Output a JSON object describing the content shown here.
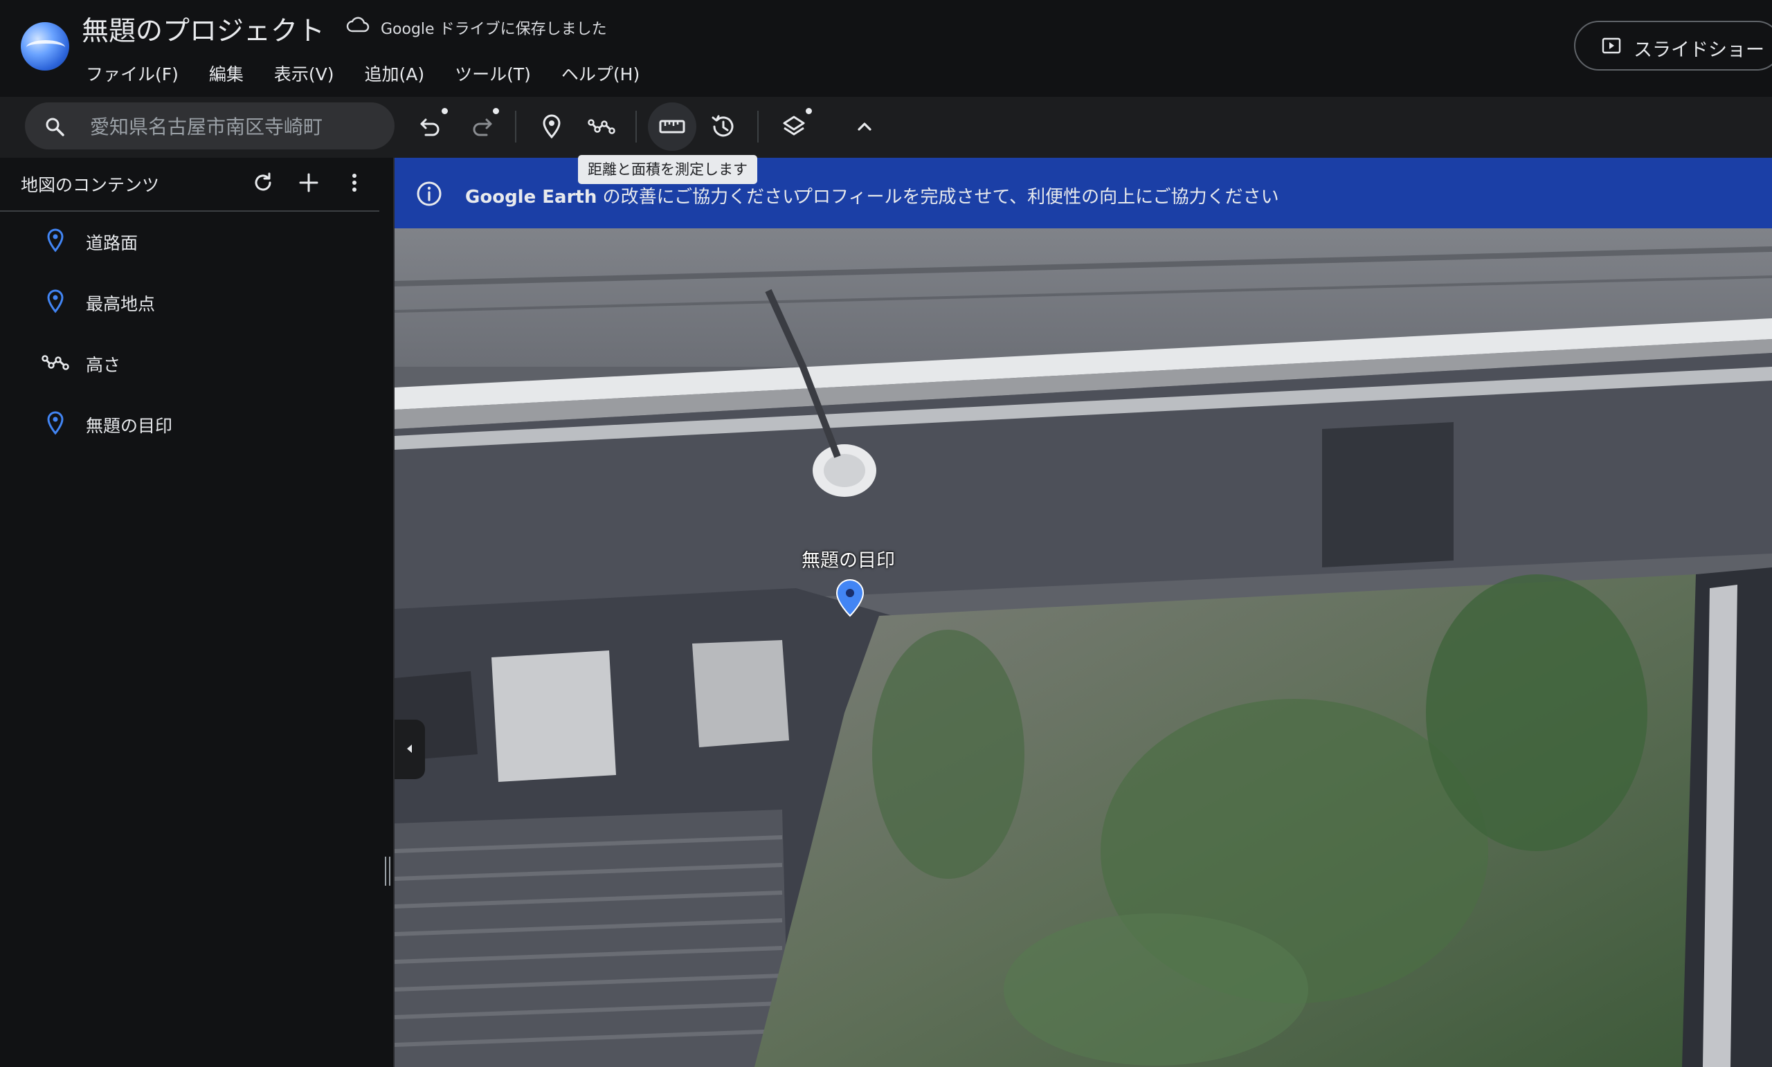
{
  "header": {
    "project_title": "無題のプロジェクト",
    "save_status": "Google ドライブに保存しました",
    "menu": [
      "ファイル(F)",
      "編集",
      "表示(V)",
      "追加(A)",
      "ツール(T)",
      "ヘルプ(H)"
    ],
    "slideshow_label": "スライドショー"
  },
  "toolbar": {
    "search_value": "愛知県名古屋市南区寺崎町",
    "tools": [
      "undo-icon",
      "redo-icon",
      "placemark-icon",
      "path-icon",
      "ruler-icon",
      "history-icon",
      "layers-icon",
      "chevron-up-icon"
    ],
    "tooltip": "距離と面積を測定します"
  },
  "sidebar": {
    "title": "地図のコンテンツ",
    "items": [
      {
        "label": "道路面",
        "icon": "pin-icon"
      },
      {
        "label": "最高地点",
        "icon": "pin-icon"
      },
      {
        "label": "高さ",
        "icon": "path-icon"
      },
      {
        "label": "無題の目印",
        "icon": "pin-icon"
      }
    ]
  },
  "banner": {
    "text_bold": "Google Earth",
    "text": " の改善にご協力ください",
    "link": "プロフィールを完成させて、利便性の向上にご協力ください"
  },
  "map": {
    "placemark_label": "無題の目印"
  },
  "colors": {
    "accent_blue": "#1b3fa6",
    "pin_blue": "#4285f4"
  }
}
